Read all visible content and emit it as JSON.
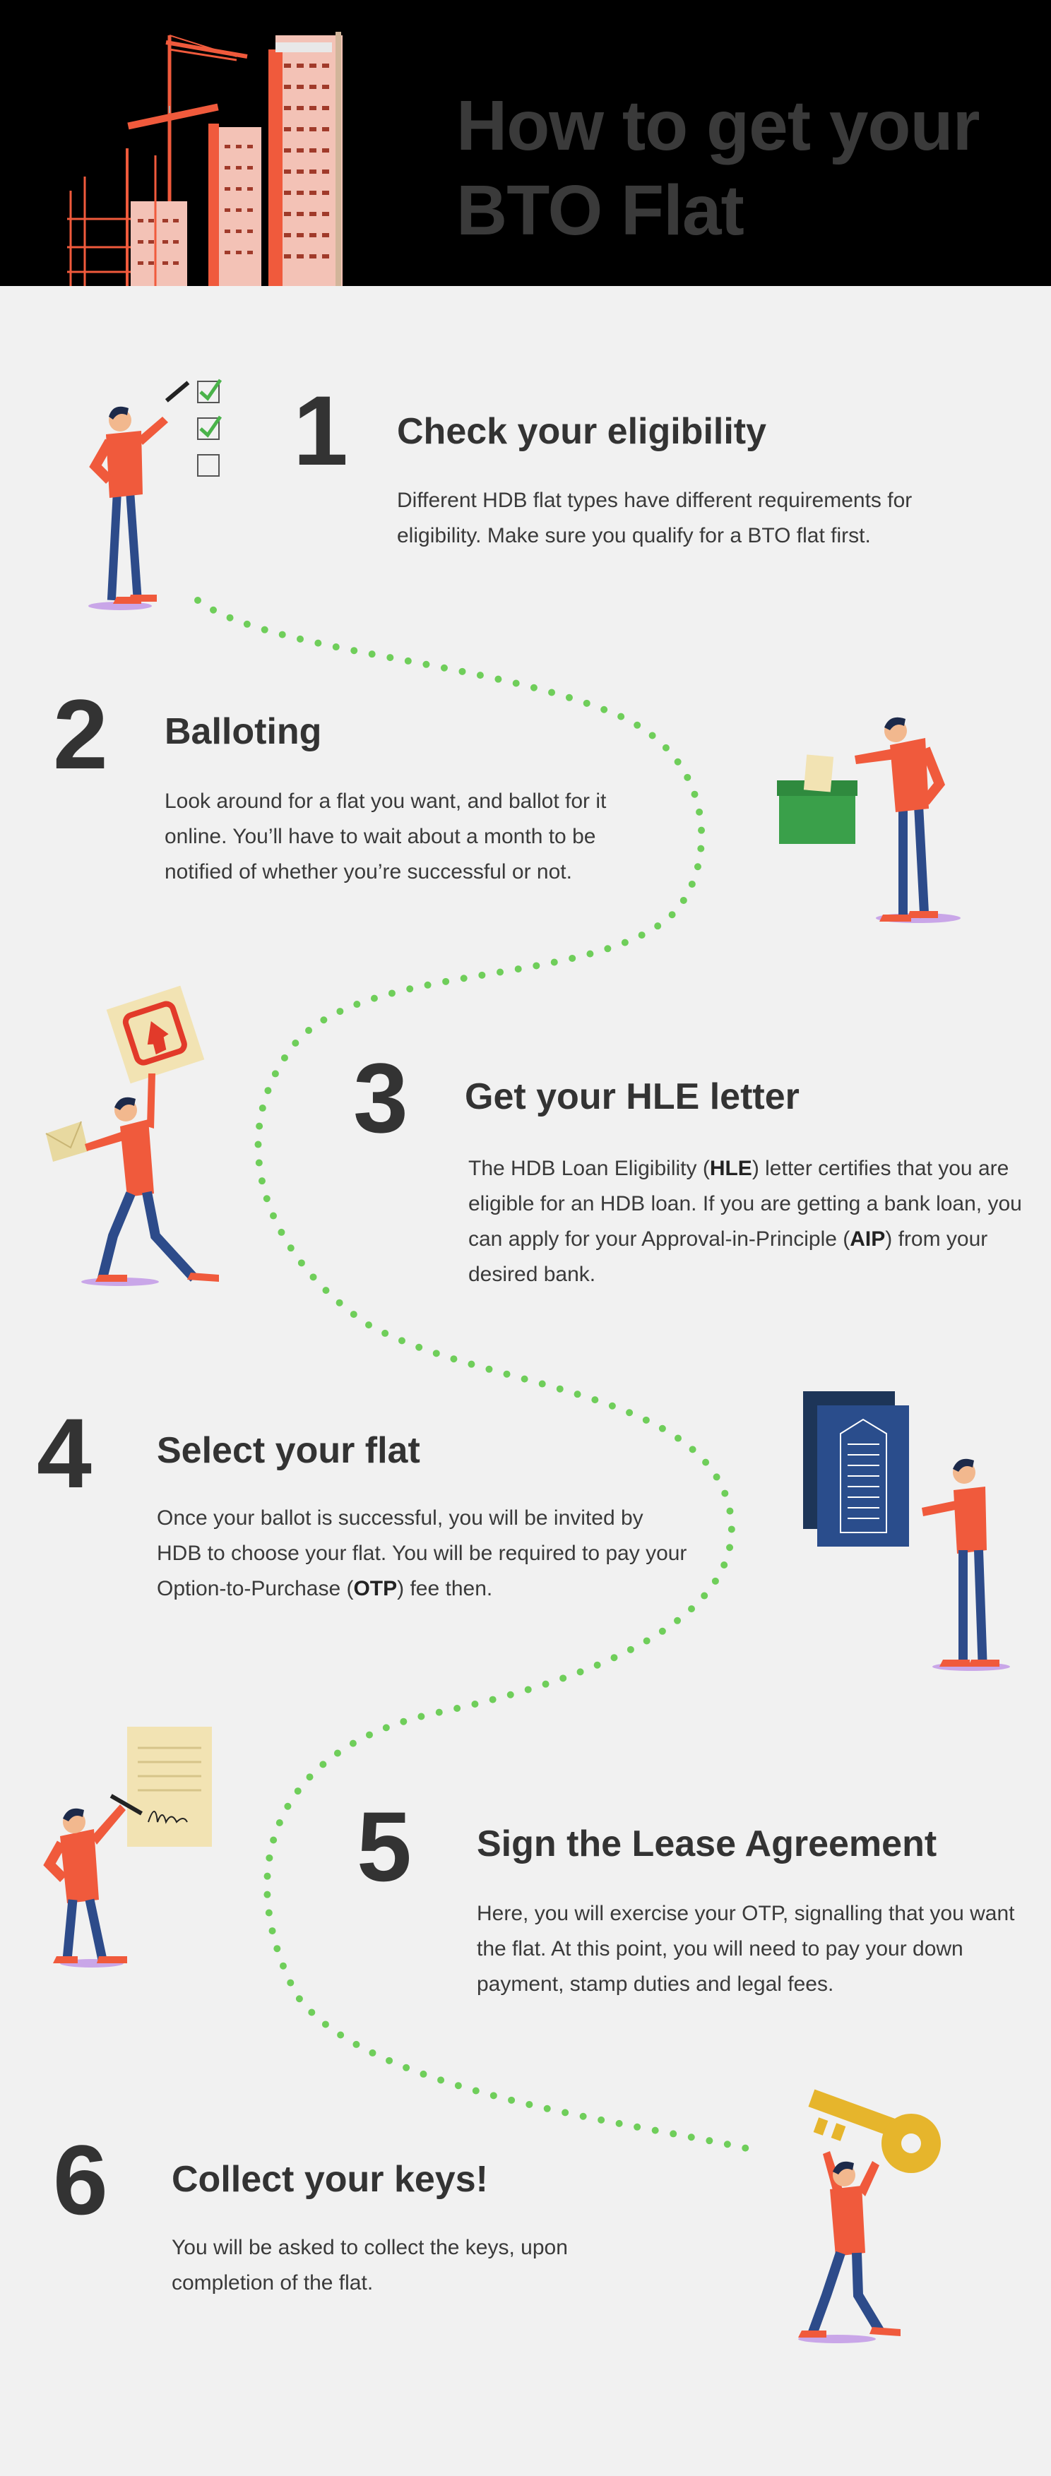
{
  "header": {
    "title_line1": "How to get your",
    "title_line2": "BTO Flat"
  },
  "steps": [
    {
      "number": "1",
      "title": "Check your eligibility",
      "description": "Different HDB flat types have different requirements for eligibility. Make sure you qualify for a BTO flat first."
    },
    {
      "number": "2",
      "title": "Balloting",
      "description": "Look around for a flat you want, and ballot for it online. You’ll have to wait about a month to be notified of whether you’re successful or not."
    },
    {
      "number": "3",
      "title": "Get your HLE letter",
      "description_parts": [
        "The HDB Loan Eligibility (",
        "HLE",
        ") letter certifies that you are eligible for an HDB loan. If you are getting a bank loan, you can apply for your Approval-in-Principle (",
        "AIP",
        ") from your desired bank."
      ]
    },
    {
      "number": "4",
      "title": "Select your flat",
      "description_parts": [
        "Once your ballot is successful, you will be invited by HDB to choose your flat. You will be required to pay your Option-to-Purchase (",
        "OTP",
        ") fee then."
      ]
    },
    {
      "number": "5",
      "title": "Sign the Lease Agreement",
      "description": "Here, you will exercise your OTP, signalling that you want the flat. At this point, you will need to pay your down payment, stamp duties and legal fees."
    },
    {
      "number": "6",
      "title": "Collect your keys!",
      "description": "You will be asked to collect the keys, upon completion of the flat."
    }
  ],
  "colors": {
    "background": "#f1f1f1",
    "header_bg": "#000000",
    "text_dark": "#333333",
    "shirt": "#f05a3c",
    "pants": "#2d4b8a",
    "path_dots": "#6fce5a",
    "ballot_box": "#3aa04a",
    "building_panel": "#2a4d8c",
    "key": "#e6b52c",
    "paper": "#f2e3b3"
  },
  "icons": [
    "construction-crane-icon",
    "checkbox-checked-icon",
    "checkbox-empty-icon",
    "ballot-box-icon",
    "letter-icon",
    "house-sign-icon",
    "building-blueprint-icon",
    "contract-document-icon",
    "pen-icon",
    "key-icon"
  ]
}
